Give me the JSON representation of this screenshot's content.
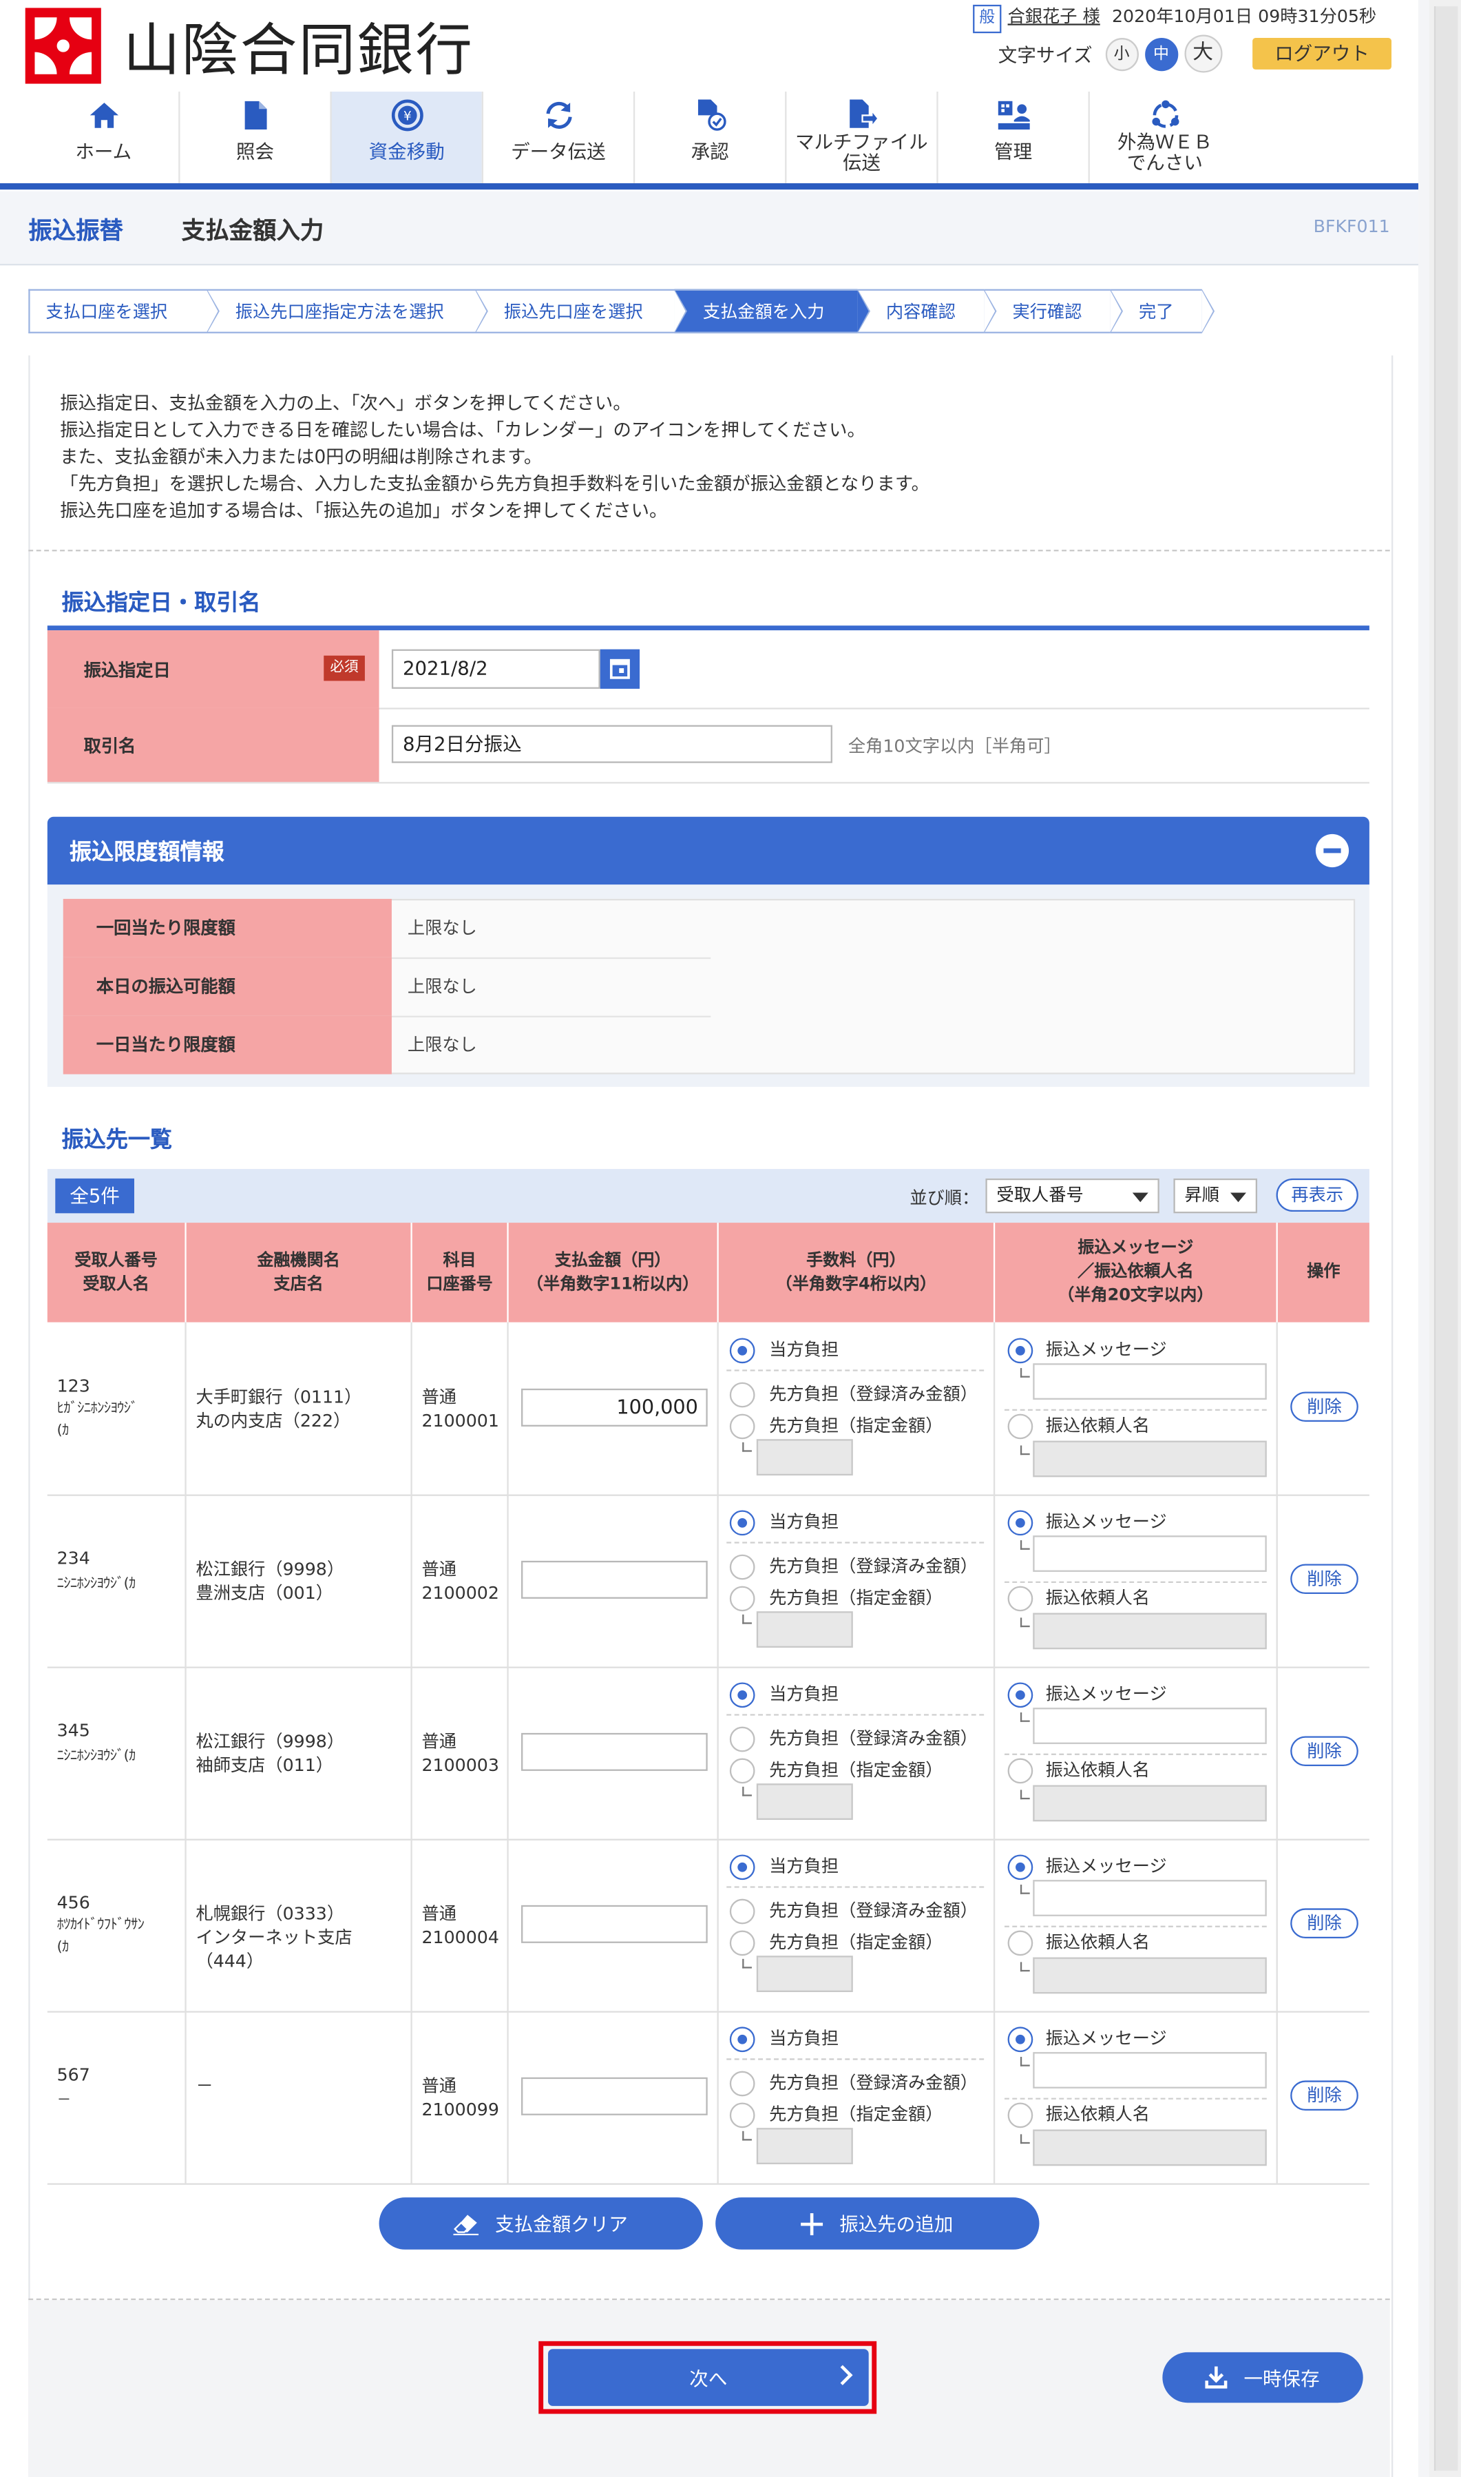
{
  "header": {
    "bank_name": "山陰合同銀行",
    "user_badge": "般",
    "user_name": "合銀花子 様",
    "datetime": "2020年10月01日 09時31分05秒",
    "font_size_label": "文字サイズ",
    "font_sizes": [
      "小",
      "中",
      "大"
    ],
    "logout": "ログアウト"
  },
  "nav": [
    {
      "label": "ホーム",
      "icon": "home-icon"
    },
    {
      "label": "照会",
      "icon": "document-icon"
    },
    {
      "label": "資金移動",
      "icon": "money-transfer-icon"
    },
    {
      "label": "データ伝送",
      "icon": "sync-icon"
    },
    {
      "label": "承認",
      "icon": "approve-icon"
    },
    {
      "label": "マルチファイル\n伝送",
      "icon": "multi-file-icon"
    },
    {
      "label": "管理",
      "icon": "admin-icon"
    },
    {
      "label": "外為ＷＥＢ\nでんさい",
      "icon": "foreign-exchange-icon"
    }
  ],
  "page": {
    "category": "振込振替",
    "title": "支払金額入力",
    "screen_id": "BFKF011"
  },
  "steps": [
    "支払口座を選択",
    "振込先口座指定方法を選択",
    "振込先口座を選択",
    "支払金額を入力",
    "内容確認",
    "実行確認",
    "完了"
  ],
  "intro": [
    "振込指定日、支払金額を入力の上、「次へ」ボタンを押してください。",
    "振込指定日として入力できる日を確認したい場合は、「カレンダー」のアイコンを押してください。",
    "また、支払金額が未入力または0円の明細は削除されます。",
    "「先方負担」を選択した場合、入力した支払金額から先方負担手数料を引いた金額が振込金額となります。",
    "振込先口座を追加する場合は、「振込先の追加」ボタンを押してください。"
  ],
  "transfer_info": {
    "heading": "振込指定日・取引名",
    "date_label": "振込指定日",
    "required": "必須",
    "date_value": "2021/8/2",
    "name_label": "取引名",
    "name_value": "8月2日分振込",
    "name_hint": "全角10文字以内［半角可］"
  },
  "limits": {
    "heading": "振込限度額情報",
    "rows": [
      {
        "label": "一回当たり限度額",
        "value": "上限なし"
      },
      {
        "label": "本日の振込可能額",
        "value": "上限なし"
      },
      {
        "label": "一日当たり限度額",
        "value": "上限なし"
      }
    ]
  },
  "list": {
    "heading": "振込先一覧",
    "count": "全5件",
    "sort_label": "並び順：",
    "sort_key": "受取人番号",
    "sort_order": "昇順",
    "redisplay": "再表示",
    "columns": [
      "受取人番号\n受取人名",
      "金融機関名\n支店名",
      "科目\n口座番号",
      "支払金額（円）\n（半角数字11桁以内）",
      "手数料（円）\n（半角数字4桁以内）",
      "振込メッセージ\n／振込依頼人名\n（半角20文字以内）",
      "操作"
    ],
    "fee_options": [
      "当方負担",
      "先方負担（登録済み金額）",
      "先方負担（指定金額）"
    ],
    "msg_options": [
      "振込メッセージ",
      "振込依頼人名"
    ],
    "delete_label": "削除",
    "rows": [
      {
        "payee_no": "123",
        "payee_name": "ﾋｶﾞｼﾆﾎﾝｼﾖｳｼﾞ\n(ｶ",
        "bank": "大手町銀行（0111）\n丸の内支店（222）",
        "account": "普通\n2100001",
        "amount": "100,000"
      },
      {
        "payee_no": "234",
        "payee_name": "ﾆｼﾆﾎﾝｼﾖｳｼﾞ(ｶ",
        "bank": "松江銀行（9998）\n豊洲支店（001）",
        "account": "普通\n2100002",
        "amount": ""
      },
      {
        "payee_no": "345",
        "payee_name": "ﾆｼﾆﾎﾝｼﾖｳｼﾞ(ｶ",
        "bank": "松江銀行（9998）\n袖師支店（011）",
        "account": "普通\n2100003",
        "amount": ""
      },
      {
        "payee_no": "456",
        "payee_name": "ﾎﾂｶｲﾄﾞｳﾌﾄﾞｳｻﾝ\n(ｶ",
        "bank": "札幌銀行（0333）\nインターネット支店\n（444）",
        "account": "普通\n2100004",
        "amount": ""
      },
      {
        "payee_no": "567",
        "payee_name": "－",
        "bank": "－",
        "account": "普通\n2100099",
        "amount": ""
      }
    ]
  },
  "actions": {
    "clear": "支払金額クリア",
    "add": "振込先の追加",
    "next": "次へ",
    "save": "一時保存"
  }
}
